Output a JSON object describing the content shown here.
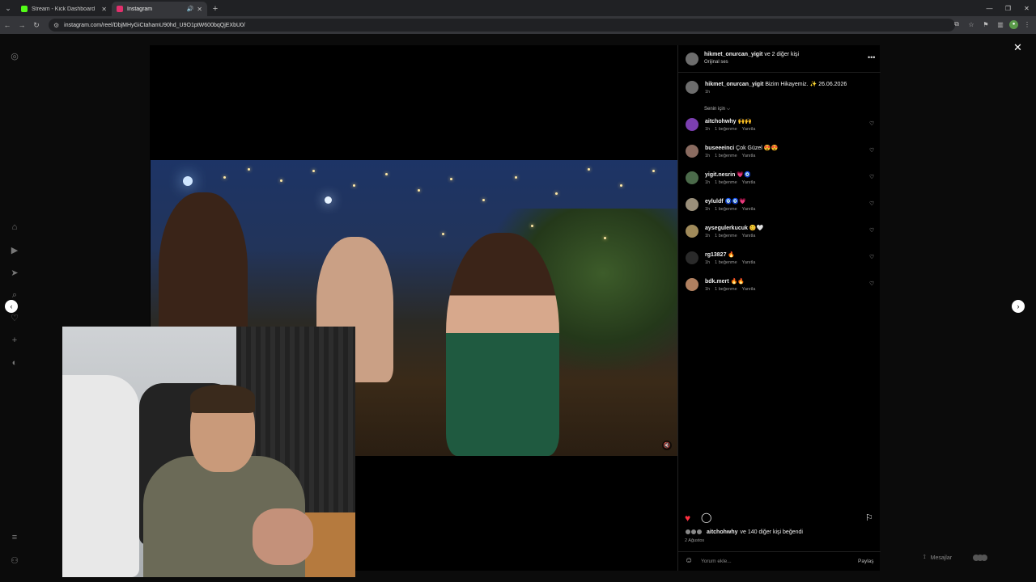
{
  "browser": {
    "tabs": [
      {
        "title": "Stream - Kick Dashboard",
        "favicon_color": "#53fc18"
      },
      {
        "title": "Instagram",
        "favicon_color": "#e1306c"
      }
    ],
    "url": "instagram.com/reel/DbjMHyGiCtahamU90hd_U9O1ptW600bqQjEXbU0/"
  },
  "post": {
    "header_user": "hikmet_onurcan_yigit",
    "header_suffix": "ve 2 diğer kişi",
    "audio": "Orijinal ses",
    "caption_user": "hikmet_onurcan_yigit",
    "caption_text": "Bizim Hikayemiz. ✨ 26.06.2026",
    "caption_time": "1h",
    "for_you": "Senin için ⌵",
    "comments": [
      {
        "user": "aitchohwhy",
        "text": "🙌🙌",
        "time": "1h",
        "likes": "1 beğenme",
        "reply": "Yanıtla",
        "avatar_color": "#7b3fb0"
      },
      {
        "user": "buseeeinci",
        "text": "Çok Güzel 😍😍",
        "time": "1h",
        "likes": "1 beğenme",
        "reply": "Yanıtla",
        "avatar_color": "#8a6b60"
      },
      {
        "user": "yigit.nesrin",
        "text": "💗🧿",
        "time": "1h",
        "likes": "1 beğenme",
        "reply": "Yanıtla",
        "avatar_color": "#4b6a4a"
      },
      {
        "user": "eyluldf",
        "text": "🧿🧿💗",
        "time": "1h",
        "likes": "1 beğenme",
        "reply": "Yanıtla",
        "avatar_color": "#9a8f7a"
      },
      {
        "user": "aysegulerkucuk",
        "text": "😊🤍",
        "time": "1h",
        "likes": "1 beğenme",
        "reply": "Yanıtla",
        "avatar_color": "#a08a5a"
      },
      {
        "user": "rg13827",
        "text": "🔥",
        "time": "1h",
        "likes": "1 beğenme",
        "reply": "Yanıtla",
        "avatar_color": "#2a2a2a"
      },
      {
        "user": "bdk.mert",
        "text": "🔥🔥",
        "time": "1h",
        "likes": "1 beğenme",
        "reply": "Yanıtla",
        "avatar_color": "#b08060"
      }
    ],
    "liked_by_user": "aitchohwhy",
    "liked_by_rest": "ve 140 diğer kişi beğendi",
    "date": "2 Ağustos",
    "comment_placeholder": "Yorum ekle...",
    "share_label": "Paylaş"
  },
  "messages_label": "Mesajlar",
  "icons": {
    "sidebar": [
      "instagram-icon",
      "home-icon",
      "reels-icon",
      "send-icon",
      "search-icon",
      "heart-icon",
      "create-icon",
      "profile-icon",
      "menu-icon",
      "meta-icon"
    ]
  }
}
